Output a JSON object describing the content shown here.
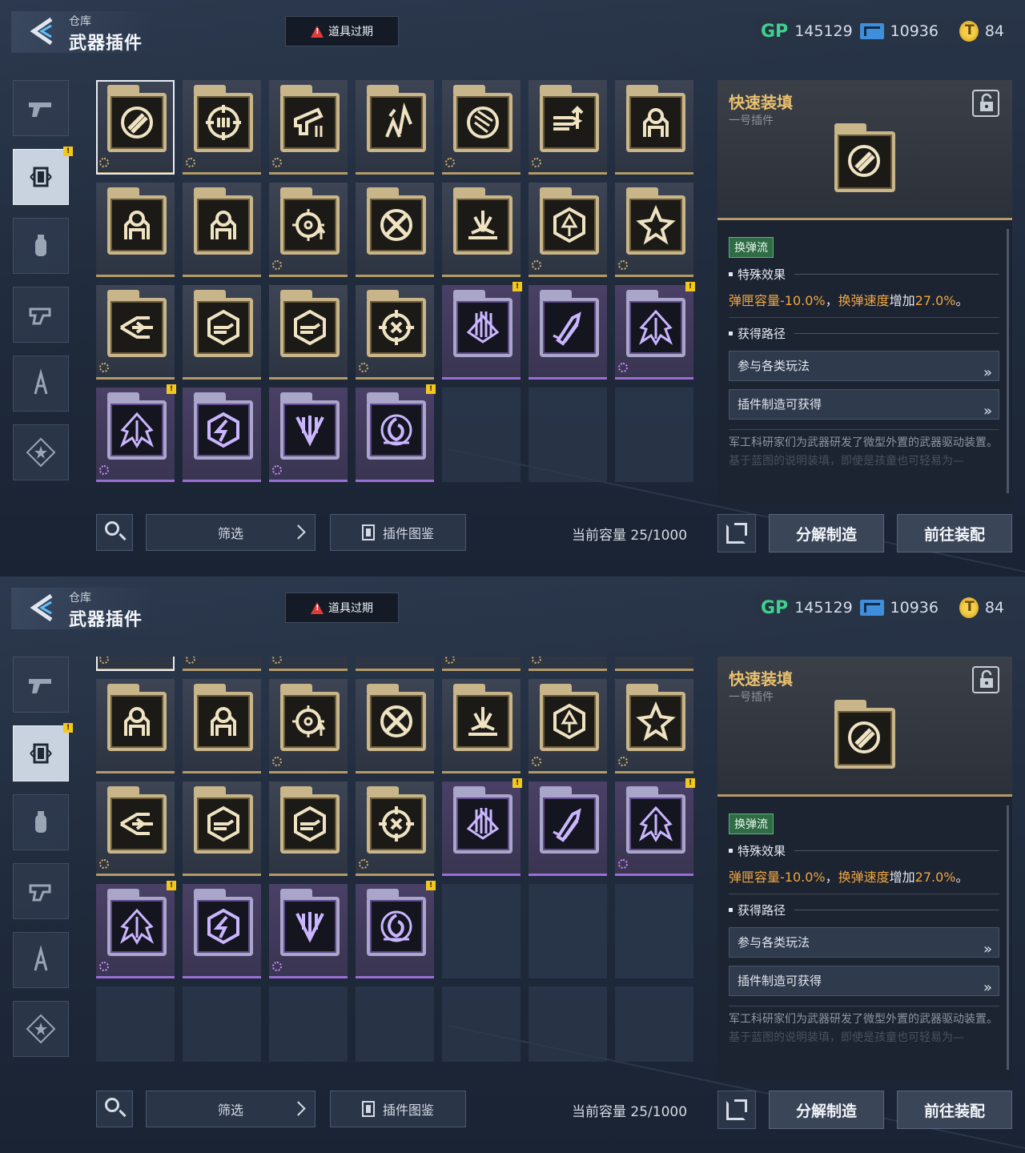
{
  "header": {
    "crumb": "仓库",
    "title": "武器插件",
    "expire_label": "道具过期"
  },
  "currencies": [
    {
      "icon": "gp-icon",
      "label": "GP",
      "value": "145129"
    },
    {
      "icon": "ticket-icon",
      "value": "10936"
    },
    {
      "icon": "coin-icon",
      "value": "84"
    }
  ],
  "sidebar": {
    "items": [
      {
        "icon": "pistol-icon",
        "active": false
      },
      {
        "icon": "plugin-icon",
        "active": true,
        "badge": "!"
      },
      {
        "icon": "grenade-icon",
        "active": false
      },
      {
        "icon": "gadget-icon",
        "active": false
      },
      {
        "icon": "character-icon",
        "active": false
      },
      {
        "icon": "star-badge-icon",
        "active": false
      }
    ]
  },
  "grid": {
    "items": [
      {
        "rarity": "gold",
        "icon": "reload-bullets-icon",
        "selected": true,
        "cog": true
      },
      {
        "rarity": "gold",
        "icon": "crosshair-ammo-icon",
        "cog": true
      },
      {
        "rarity": "gold",
        "icon": "gun-upgrade-icon",
        "cog": true
      },
      {
        "rarity": "gold",
        "icon": "arrows-up-icon"
      },
      {
        "rarity": "gold",
        "icon": "magazine-cycle-icon",
        "cog": true
      },
      {
        "rarity": "gold",
        "icon": "bullet-speed-icon",
        "cog": true
      },
      {
        "rarity": "gold",
        "icon": "turret-icon"
      },
      {
        "rarity": "gold",
        "icon": "turret-icon"
      },
      {
        "rarity": "gold",
        "icon": "turret-icon"
      },
      {
        "rarity": "gold",
        "icon": "target-up-icon",
        "cog": true
      },
      {
        "rarity": "gold",
        "icon": "crossed-bullets-icon"
      },
      {
        "rarity": "gold",
        "icon": "impact-icon"
      },
      {
        "rarity": "gold",
        "icon": "hex-arrow-icon",
        "cog": true
      },
      {
        "rarity": "gold",
        "icon": "star-burst-icon",
        "cog": true
      },
      {
        "rarity": "gold",
        "icon": "fast-shot-icon",
        "cog": true
      },
      {
        "rarity": "gold",
        "icon": "bullet-hex-icon"
      },
      {
        "rarity": "gold",
        "icon": "bullet-hex-icon"
      },
      {
        "rarity": "gold",
        "icon": "compass-target-icon",
        "cog": true
      },
      {
        "rarity": "purple",
        "icon": "shield-columns-icon",
        "badge": "!"
      },
      {
        "rarity": "purple",
        "icon": "twin-rockets-icon"
      },
      {
        "rarity": "purple",
        "icon": "jet-up-icon",
        "badge": "!",
        "cog": true
      },
      {
        "rarity": "purple",
        "icon": "jet-up-icon",
        "badge": "!",
        "cog": true
      },
      {
        "rarity": "purple",
        "icon": "lightning-hex-icon"
      },
      {
        "rarity": "purple",
        "icon": "drill-down-icon",
        "cog": true
      },
      {
        "rarity": "purple",
        "icon": "vortex-icon",
        "badge": "!"
      }
    ],
    "empty_slots_view1": 3,
    "empty_slots_view2": 10,
    "scroll_view2_rows_hidden": 1
  },
  "toolbar": {
    "filter_label": "筛选",
    "codex_label": "插件图鉴",
    "capacity_label": "当前容量 25/1000"
  },
  "detail": {
    "name": "快速装填",
    "slot": "一号插件",
    "tag": "换弹流",
    "effect_title": "特殊效果",
    "effect_parts": [
      "弹匣容量",
      "-10.0%",
      "，",
      "换弹速度",
      "增加",
      "27.0%",
      "。"
    ],
    "route_title": "获得路径",
    "routes": [
      "参与各类玩法",
      "插件制造可获得"
    ],
    "description": "军工科研家们为武器研发了微型外置的武器驱动装置。",
    "description_more": "基于蓝图的说明装填，即使是孩童也可轻易为—"
  },
  "actions": {
    "dismantle_label": "分解制造",
    "equip_label": "前往装配"
  },
  "colors": {
    "gold_rarity": "#c9b58a",
    "purple_rarity": "#9a6fd4",
    "effect_text": "#f0a742",
    "title_gold": "#e9c06e",
    "tag_green": "#2f6b45",
    "alert": "#e03b3b"
  }
}
